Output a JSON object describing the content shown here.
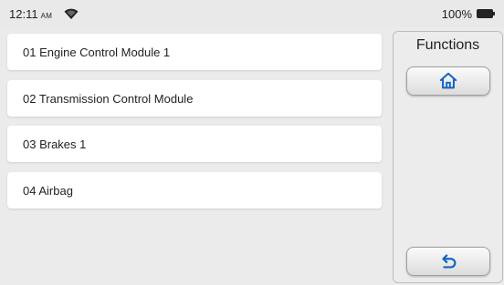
{
  "status_bar": {
    "time": "12:11",
    "ampm": "AM",
    "battery_text": "100%",
    "icons": [
      "wifi-icon",
      "battery-icon"
    ]
  },
  "modules": [
    {
      "label": "01 Engine Control Module 1"
    },
    {
      "label": "02 Transmission Control Module"
    },
    {
      "label": "03 Brakes 1"
    },
    {
      "label": "04 Airbag"
    }
  ],
  "functions": {
    "title": "Functions",
    "buttons": [
      {
        "icon": "home-icon"
      },
      {
        "icon": "back-icon"
      }
    ]
  },
  "colors": {
    "accent": "#1565c0",
    "background": "#ebebeb",
    "item_background": "#ffffff"
  }
}
